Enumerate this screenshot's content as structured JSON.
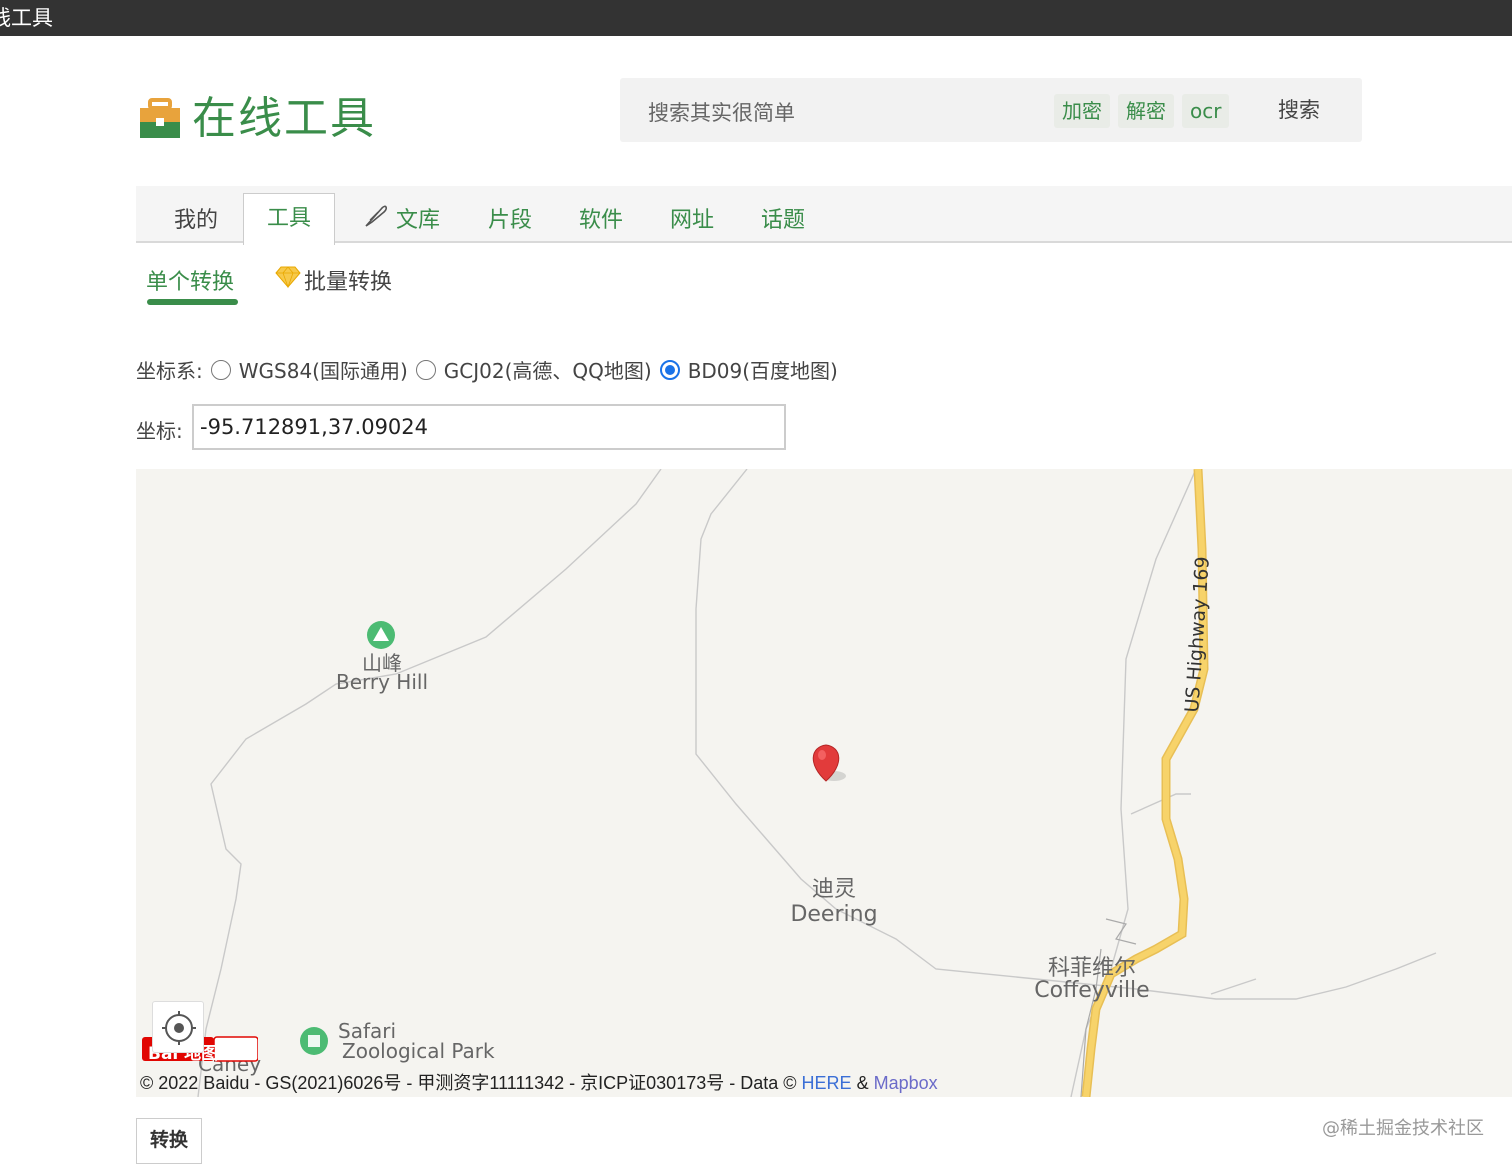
{
  "window": {
    "title": "线工具"
  },
  "header": {
    "site_name": "在线工具",
    "logo_icon": "briefcase-icon",
    "search": {
      "placeholder": "搜索其实很简单",
      "chips": [
        "加密",
        "解密",
        "ocr"
      ],
      "button": "搜索"
    }
  },
  "nav": {
    "tabs": [
      {
        "label": "我的"
      },
      {
        "label": "工具",
        "active": true
      },
      {
        "label": "文库",
        "icon": "feather-icon"
      },
      {
        "label": "片段"
      },
      {
        "label": "软件"
      },
      {
        "label": "网址"
      },
      {
        "label": "话题"
      }
    ]
  },
  "subtabs": [
    {
      "label": "单个转换",
      "active": true
    },
    {
      "label": "批量转换",
      "icon": "diamond-icon"
    }
  ],
  "form": {
    "system_label": "坐标系:",
    "options": [
      {
        "label": "WGS84(国际通用)",
        "checked": false
      },
      {
        "label": "GCJ02(高德、QQ地图)",
        "checked": false
      },
      {
        "label": "BD09(百度地图)",
        "checked": true
      }
    ],
    "coord_label": "坐标:",
    "coord_value": "-95.712891,37.09024",
    "convert_button": "转换"
  },
  "map": {
    "labels": {
      "peak_cn": "山峰",
      "peak_en": "Berry Hill",
      "town_cn": "迪灵",
      "town_en": "Deering",
      "city_cn": "科菲维尔",
      "city_en": "Coffeyville",
      "park_line1": "Safari",
      "park_line2": "Zoological Park",
      "highway": "US Highway 169",
      "partial_label": "Caney"
    },
    "logo_text": "Bai 地图",
    "copyright": {
      "text": "© 2022 Baidu - GS(2021)6026号 - 甲测资字11111342 - 京ICP证030173号 - Data ©",
      "link1": "HERE",
      "amp": "&",
      "link2": "Mapbox"
    },
    "colors": {
      "highway": "#f7d36a",
      "marker": "#e23b3b",
      "road": "#c8c8c8",
      "background": "#f5f4f0"
    }
  },
  "watermark": "@稀土掘金技术社区"
}
